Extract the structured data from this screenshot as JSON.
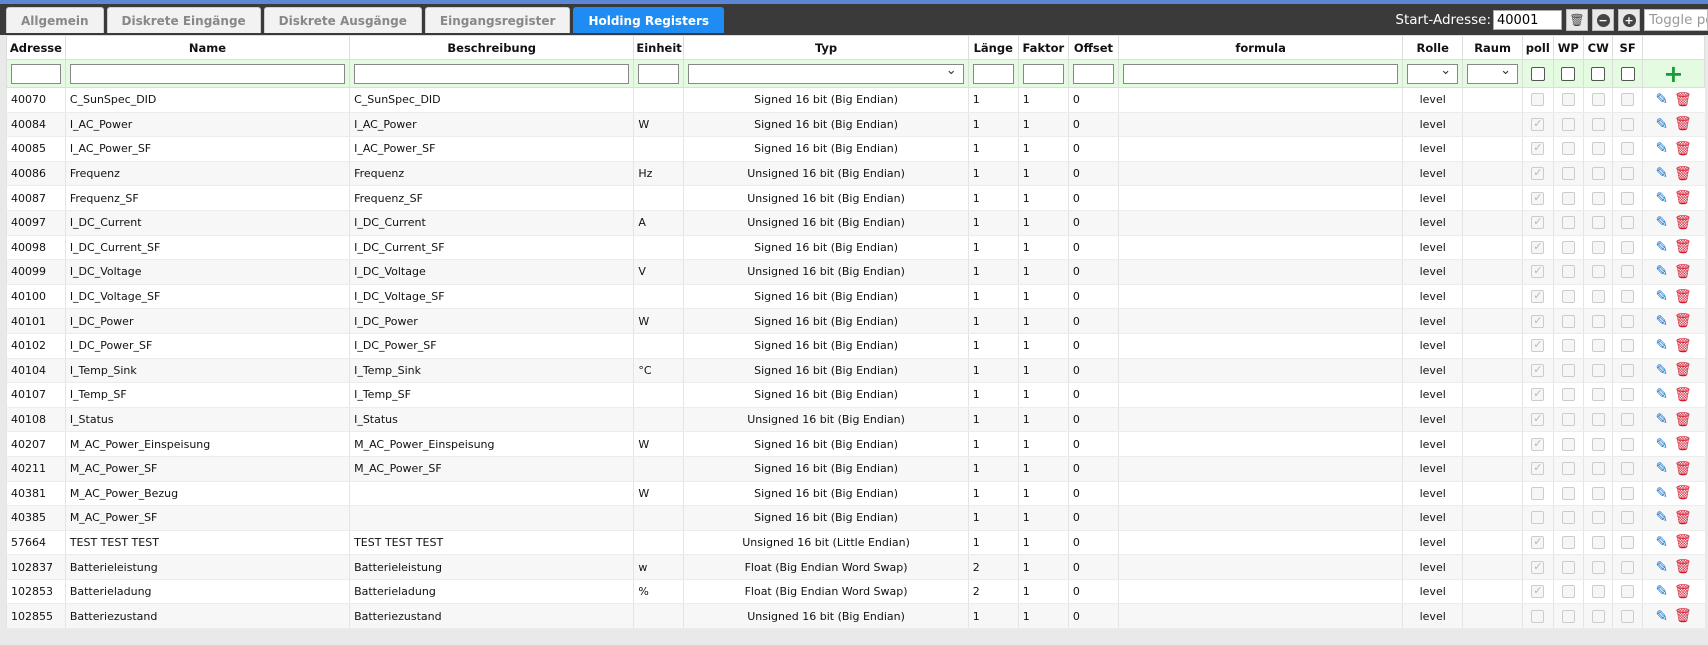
{
  "tabs": [
    {
      "label": "Allgemein",
      "active": false
    },
    {
      "label": "Diskrete Eingänge",
      "active": false
    },
    {
      "label": "Diskrete Ausgänge",
      "active": false
    },
    {
      "label": "Eingangsregister",
      "active": false
    },
    {
      "label": "Holding Registers",
      "active": true
    }
  ],
  "toolbar": {
    "start_label": "Start-Adresse:",
    "start_value": "40001",
    "toggle_placeholder": "Toggle poll"
  },
  "columns": [
    "Adresse",
    "Name",
    "Beschreibung",
    "Einheit",
    "Typ",
    "Länge",
    "Faktor",
    "Offset",
    "formula",
    "Rolle",
    "Raum",
    "poll",
    "WP",
    "CW",
    "SF"
  ],
  "rows": [
    {
      "addr": "40070",
      "name": "C_SunSpec_DID",
      "desc": "C_SunSpec_DID",
      "unit": "",
      "type": "Signed 16 bit (Big Endian)",
      "len": "1",
      "factor": "1",
      "offset": "0",
      "role": "level",
      "poll": false
    },
    {
      "addr": "40084",
      "name": "I_AC_Power",
      "desc": "I_AC_Power",
      "unit": "W",
      "type": "Signed 16 bit (Big Endian)",
      "len": "1",
      "factor": "1",
      "offset": "0",
      "role": "level",
      "poll": true
    },
    {
      "addr": "40085",
      "name": "I_AC_Power_SF",
      "desc": "I_AC_Power_SF",
      "unit": "",
      "type": "Signed 16 bit (Big Endian)",
      "len": "1",
      "factor": "1",
      "offset": "0",
      "role": "level",
      "poll": true
    },
    {
      "addr": "40086",
      "name": "Frequenz",
      "desc": "Frequenz",
      "unit": "Hz",
      "type": "Unsigned 16 bit (Big Endian)",
      "len": "1",
      "factor": "1",
      "offset": "0",
      "role": "level",
      "poll": true
    },
    {
      "addr": "40087",
      "name": "Frequenz_SF",
      "desc": "Frequenz_SF",
      "unit": "",
      "type": "Unsigned 16 bit (Big Endian)",
      "len": "1",
      "factor": "1",
      "offset": "0",
      "role": "level",
      "poll": true
    },
    {
      "addr": "40097",
      "name": "I_DC_Current",
      "desc": "I_DC_Current",
      "unit": "A",
      "type": "Unsigned 16 bit (Big Endian)",
      "len": "1",
      "factor": "1",
      "offset": "0",
      "role": "level",
      "poll": true
    },
    {
      "addr": "40098",
      "name": "I_DC_Current_SF",
      "desc": "I_DC_Current_SF",
      "unit": "",
      "type": "Signed 16 bit (Big Endian)",
      "len": "1",
      "factor": "1",
      "offset": "0",
      "role": "level",
      "poll": true
    },
    {
      "addr": "40099",
      "name": "I_DC_Voltage",
      "desc": "I_DC_Voltage",
      "unit": "V",
      "type": "Unsigned 16 bit (Big Endian)",
      "len": "1",
      "factor": "1",
      "offset": "0",
      "role": "level",
      "poll": true
    },
    {
      "addr": "40100",
      "name": "I_DC_Voltage_SF",
      "desc": "I_DC_Voltage_SF",
      "unit": "",
      "type": "Signed 16 bit (Big Endian)",
      "len": "1",
      "factor": "1",
      "offset": "0",
      "role": "level",
      "poll": true
    },
    {
      "addr": "40101",
      "name": "I_DC_Power",
      "desc": "I_DC_Power",
      "unit": "W",
      "type": "Signed 16 bit (Big Endian)",
      "len": "1",
      "factor": "1",
      "offset": "0",
      "role": "level",
      "poll": true
    },
    {
      "addr": "40102",
      "name": "I_DC_Power_SF",
      "desc": "I_DC_Power_SF",
      "unit": "",
      "type": "Signed 16 bit (Big Endian)",
      "len": "1",
      "factor": "1",
      "offset": "0",
      "role": "level",
      "poll": true
    },
    {
      "addr": "40104",
      "name": "I_Temp_Sink",
      "desc": "I_Temp_Sink",
      "unit": "°C",
      "type": "Signed 16 bit (Big Endian)",
      "len": "1",
      "factor": "1",
      "offset": "0",
      "role": "level",
      "poll": true
    },
    {
      "addr": "40107",
      "name": "I_Temp_SF",
      "desc": "I_Temp_SF",
      "unit": "",
      "type": "Signed 16 bit (Big Endian)",
      "len": "1",
      "factor": "1",
      "offset": "0",
      "role": "level",
      "poll": true
    },
    {
      "addr": "40108",
      "name": "I_Status",
      "desc": "I_Status",
      "unit": "",
      "type": "Unsigned 16 bit (Big Endian)",
      "len": "1",
      "factor": "1",
      "offset": "0",
      "role": "level",
      "poll": true
    },
    {
      "addr": "40207",
      "name": "M_AC_Power_Einspeisung",
      "desc": "M_AC_Power_Einspeisung",
      "unit": "W",
      "type": "Signed 16 bit (Big Endian)",
      "len": "1",
      "factor": "1",
      "offset": "0",
      "role": "level",
      "poll": true
    },
    {
      "addr": "40211",
      "name": "M_AC_Power_SF",
      "desc": "M_AC_Power_SF",
      "unit": "",
      "type": "Signed 16 bit (Big Endian)",
      "len": "1",
      "factor": "1",
      "offset": "0",
      "role": "level",
      "poll": true
    },
    {
      "addr": "40381",
      "name": "M_AC_Power_Bezug",
      "desc": "",
      "unit": "W",
      "type": "Signed 16 bit (Big Endian)",
      "len": "1",
      "factor": "1",
      "offset": "0",
      "role": "level",
      "poll": false
    },
    {
      "addr": "40385",
      "name": "M_AC_Power_SF",
      "desc": "",
      "unit": "",
      "type": "Signed 16 bit (Big Endian)",
      "len": "1",
      "factor": "1",
      "offset": "0",
      "role": "level",
      "poll": false
    },
    {
      "addr": "57664",
      "name": "TEST TEST TEST",
      "desc": "TEST TEST TEST",
      "unit": "",
      "type": "Unsigned 16 bit (Little Endian)",
      "len": "1",
      "factor": "1",
      "offset": "0",
      "role": "level",
      "poll": true
    },
    {
      "addr": "102837",
      "name": "Batterieleistung",
      "desc": "Batterieleistung",
      "unit": "w",
      "type": "Float (Big Endian Word Swap)",
      "len": "2",
      "factor": "1",
      "offset": "0",
      "role": "level",
      "poll": true
    },
    {
      "addr": "102853",
      "name": "Batterieladung",
      "desc": "Batterieladung",
      "unit": "%",
      "type": "Float (Big Endian Word Swap)",
      "len": "2",
      "factor": "1",
      "offset": "0",
      "role": "level",
      "poll": true
    },
    {
      "addr": "102855",
      "name": "Batteriezustand",
      "desc": "Batteriezustand",
      "unit": "",
      "type": "Unsigned 16 bit (Big Endian)",
      "len": "1",
      "factor": "1",
      "offset": "0",
      "role": "level",
      "poll": false
    }
  ],
  "icons": {
    "edit": "pencil-icon",
    "delete": "trash-icon",
    "add": "plus-icon",
    "clear": "trash-icon",
    "collapse": "minus-circle-icon",
    "expand": "plus-circle-icon"
  },
  "colors": {
    "active_tab": "#1f8cf3",
    "filter_row": "#e5fbe1",
    "edit_icon": "#1a73c8",
    "delete_icon": "#d4142a",
    "add_icon": "#1a9a3a"
  }
}
